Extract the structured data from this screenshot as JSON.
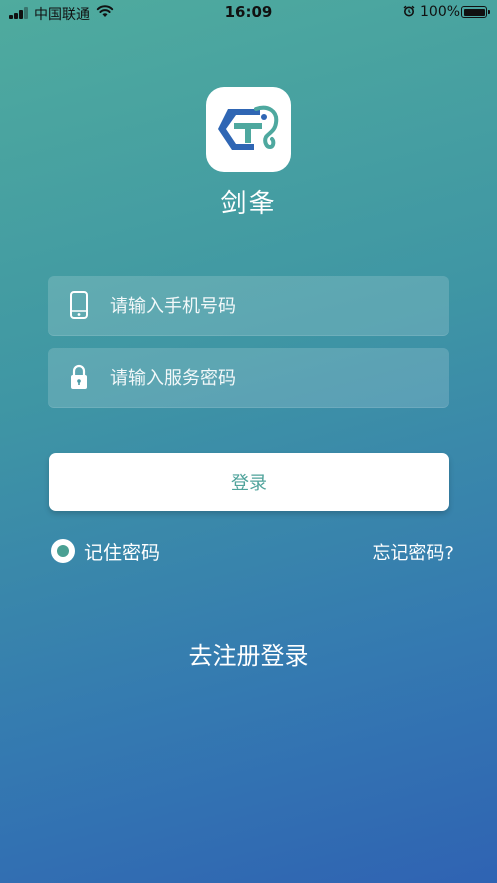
{
  "status_bar": {
    "carrier": "中国联通",
    "time": "16:09",
    "battery_percent": "100%"
  },
  "app": {
    "name": "剑夆",
    "logo_icon": "app-logo-icon"
  },
  "form": {
    "phone": {
      "placeholder": "请输入手机号码",
      "value": "",
      "icon": "phone-icon"
    },
    "password": {
      "placeholder": "请输入服务密码",
      "value": "",
      "icon": "lock-icon"
    },
    "login_label": "登录",
    "remember_label": "记住密码",
    "remember_checked": true,
    "forgot_label": "忘记密码?",
    "register_label": "去注册登录"
  },
  "colors": {
    "accent": "#4fa39b",
    "gradient_top": "#4fab9e",
    "gradient_bottom": "#2f63b3"
  }
}
